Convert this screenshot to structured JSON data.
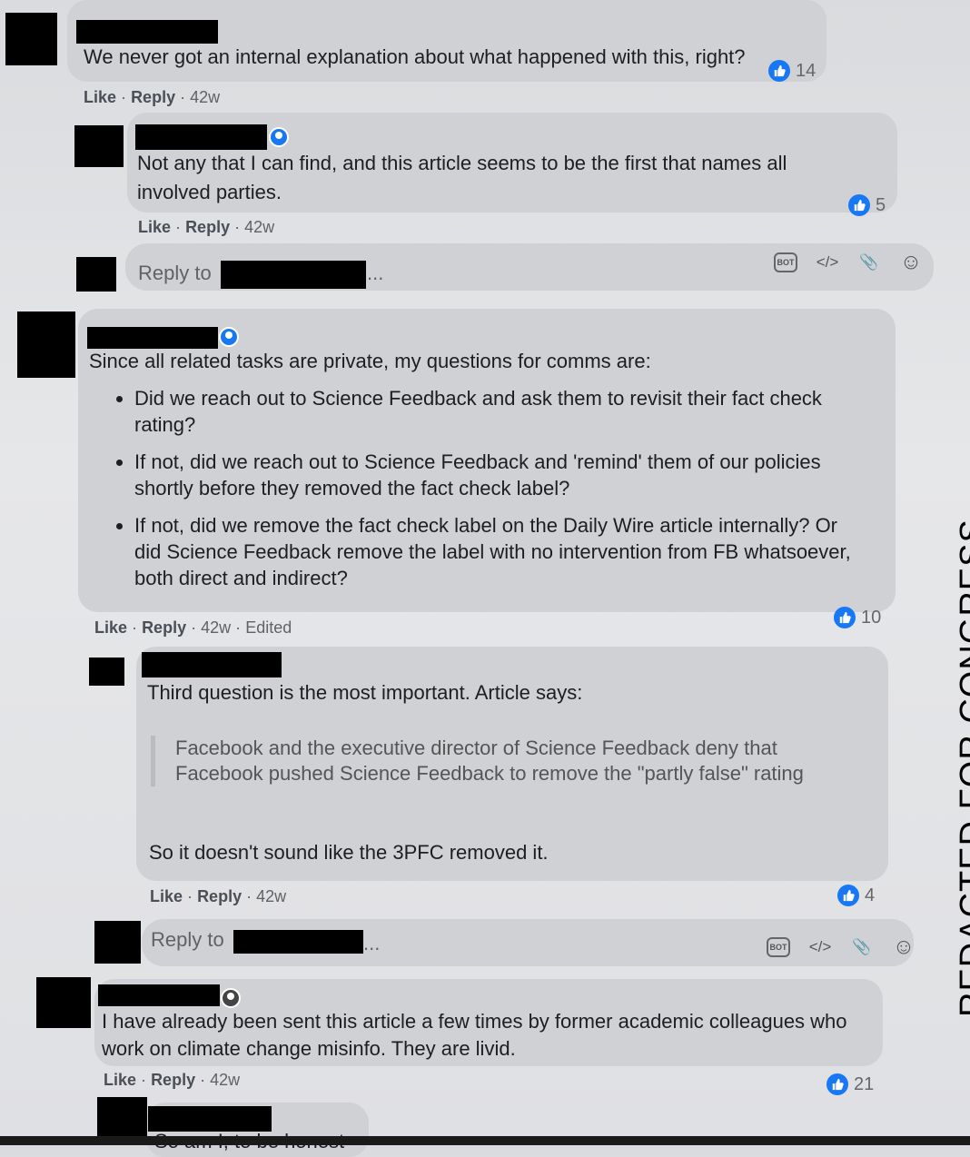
{
  "watermark": "REDACTED FOR CONGRESS",
  "common": {
    "like": "Like",
    "reply": "Reply",
    "sep": "·"
  },
  "comments": [
    {
      "text": "We never got an internal explanation about what happened with this, right?",
      "time": "42w",
      "reactions": "14"
    },
    {
      "text": "Not any that I can find, and this article seems to be the first that names all involved parties.",
      "time": "42w",
      "reactions": "5"
    },
    {
      "text": "Since all related tasks are private, my questions for comms are:",
      "bullets": [
        "Did we reach out to Science Feedback and ask them to revisit their fact check rating?",
        "If not, did we reach out to Science Feedback and 'remind' them of our policies shortly before they removed the fact check label?",
        "If not, did we remove the fact check label on the Daily Wire article internally? Or did Science Feedback remove the label with no intervention from FB whatsoever, both direct and indirect?"
      ],
      "time": "42w",
      "edited": "Edited",
      "reactions": "10"
    },
    {
      "text": "Third question is the most important. Article says:",
      "quote": "Facebook and the executive director of Science Feedback deny that Facebook pushed Science Feedback to remove the \"partly false\" rating",
      "text2": "So it doesn't sound like the 3PFC removed it.",
      "time": "42w",
      "reactions": "4"
    },
    {
      "text": "I have already been sent this article a few times by former academic colleagues who work on climate change misinfo. They are livid.",
      "time": "42w",
      "reactions": "21"
    },
    {
      "text": "So am I, to be honest"
    }
  ],
  "reply_box": {
    "placeholder": "Reply to",
    "ellipsis": "..."
  },
  "tools": {
    "bot": "BOT",
    "code": "</>",
    "attach": "📎",
    "emoji": "☺"
  },
  "colors": {
    "accent": "#1877f2",
    "bubble": "#cfd1d5"
  }
}
